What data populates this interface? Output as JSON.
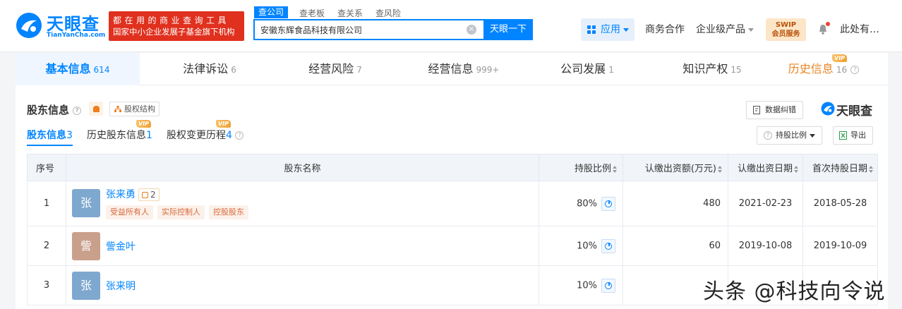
{
  "brand": {
    "name": "天眼查",
    "sub": "TianYanCha.com",
    "slogan_line1": "都在用的商业查询工具",
    "slogan_line2": "国家中小企业发展子基金旗下机构"
  },
  "search": {
    "tabs": [
      "查公司",
      "查老板",
      "查关系",
      "查风险"
    ],
    "value": "安徽东辉食品科技有限公司",
    "button": "天眼一下"
  },
  "topnav": {
    "apps": "应用",
    "business": "商务合作",
    "enterprise": "企业级产品",
    "swip_top": "SWIP",
    "swip_bottom": "会员服务",
    "user": "此处有…"
  },
  "main_tabs": [
    {
      "label": "基本信息",
      "count": "614"
    },
    {
      "label": "法律诉讼",
      "count": "6"
    },
    {
      "label": "经营风险",
      "count": "7"
    },
    {
      "label": "经营信息",
      "count": "999+"
    },
    {
      "label": "公司发展",
      "count": "1"
    },
    {
      "label": "知识产权",
      "count": "15"
    },
    {
      "label": "历史信息",
      "count": "16",
      "badge": "VIP"
    }
  ],
  "section": {
    "title": "股东信息",
    "equity_structure": "股权结构",
    "correct": "数据纠错",
    "brand_small": "天眼查",
    "ratio_filter": "持股比例",
    "export": "导出"
  },
  "sub_tabs": [
    {
      "label": "股东信息",
      "count": "3"
    },
    {
      "label": "历史股东信息",
      "count": "1",
      "badge": "VIP"
    },
    {
      "label": "股权变更历程",
      "count": "4",
      "badge": "VIP"
    }
  ],
  "table": {
    "headers": [
      "序号",
      "股东名称",
      "持股比例",
      "认缴出资额(万元)",
      "认缴出资日期",
      "首次持股日期"
    ],
    "rows": [
      {
        "index": "1",
        "avatar": "张",
        "avatar_color": "#7fa8cf",
        "name": "张来勇",
        "chain": "2",
        "tags": [
          "受益所有人",
          "实际控制人",
          "控股股东"
        ],
        "ratio": "80%",
        "amount": "480",
        "date": "2021-02-23",
        "first": "2018-05-28"
      },
      {
        "index": "2",
        "avatar": "訾",
        "avatar_color": "#c9a08c",
        "name": "訾金叶",
        "ratio": "10%",
        "amount": "60",
        "date": "2019-10-08",
        "first": "2019-10-09"
      },
      {
        "index": "3",
        "avatar": "张",
        "avatar_color": "#7fa8cf",
        "name": "张来明",
        "ratio": "10%",
        "amount": "",
        "date": "",
        "first": ""
      }
    ]
  },
  "watermark": "头条 @科技向令说",
  "colors": {
    "accent": "#0084ff",
    "slogan_bg": "#e0301e",
    "vip": "#f0a033"
  }
}
